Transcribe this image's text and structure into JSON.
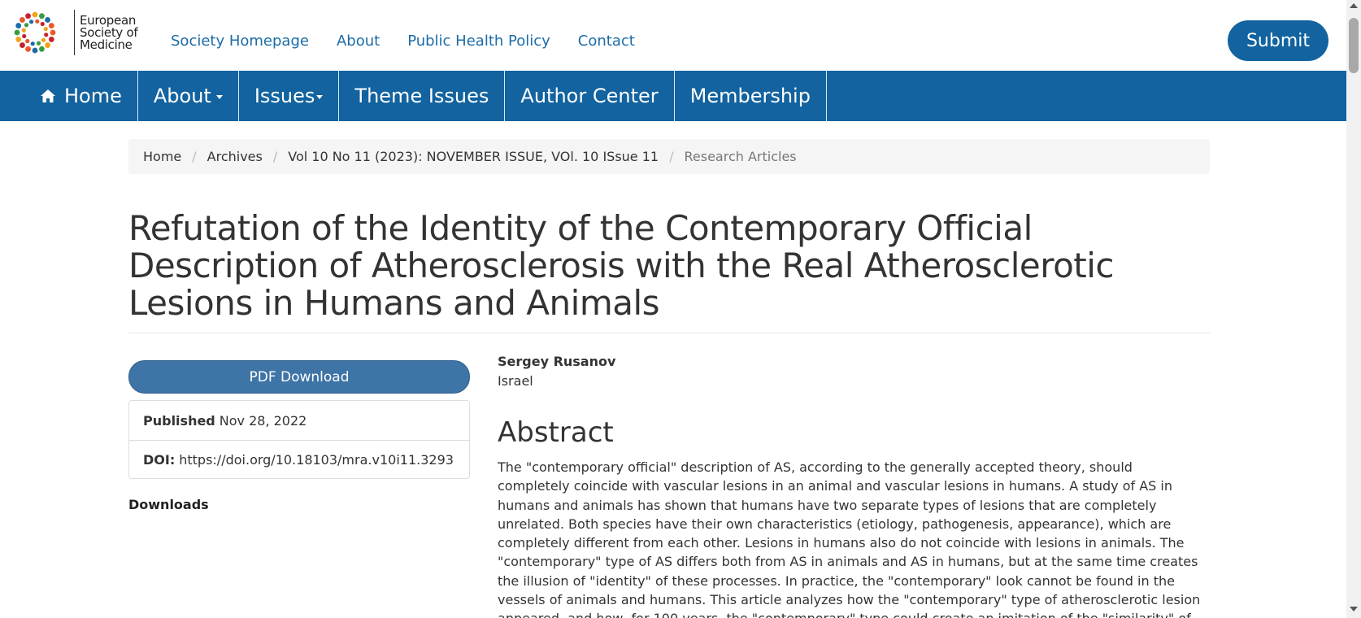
{
  "brand": {
    "name_lines": [
      "European",
      "Society of",
      "Medicine"
    ],
    "logo_dot_colors": [
      "#e8582a",
      "#f2a31b",
      "#1b6ca8",
      "#c8202f",
      "#3a9c3f"
    ]
  },
  "top_links": [
    "Society Homepage",
    "About",
    "Public Health Policy",
    "Contact"
  ],
  "submit_label": "Submit",
  "nav": {
    "home": "Home",
    "about": "About",
    "issues": "Issues",
    "theme_issues": "Theme Issues",
    "author_center": "Author Center",
    "membership": "Membership"
  },
  "breadcrumb": {
    "items": [
      "Home",
      "Archives",
      "Vol 10 No 11 (2023): NOVEMBER ISSUE, VOl. 10 ISsue 11"
    ],
    "current": "Research Articles"
  },
  "article": {
    "title": "Refutation of the Identity of the Contemporary Official Description of Atherosclerosis with the Real Atherosclerotic Lesions in Humans and Animals",
    "author": "Sergey Rusanov",
    "affiliation": "Israel",
    "pdf_label": "PDF Download",
    "published_label": "Published",
    "published_date": "Nov 28, 2022",
    "doi_label": "DOI:",
    "doi": "https://doi.org/10.18103/mra.v10i11.3293",
    "downloads_label": "Downloads",
    "abstract_heading": "Abstract",
    "abstract": "The \"contemporary official\" description of AS, according to the generally accepted theory, should completely coincide with vascular lesions in an animal and vascular lesions in humans. A study of AS in humans and animals has shown that humans have two separate types of lesions that are completely unrelated. Both species have their own characteristics (etiology, pathogenesis, appearance), which are completely different from each other. Lesions in humans also do not coincide with lesions in animals. The \"contemporary\" type of AS differs both from AS in animals and AS in humans, but at the same time creates the illusion of \"identity\" of these processes. In practice, the \"contemporary\" look cannot be found in the vessels of animals and humans. This article analyzes how the \"contemporary\" type of atherosclerotic lesion appeared, and how, for 100 years, the \"contemporary\" type could create an imitation of the \"similarity\" of completely different processes."
  },
  "colors": {
    "primary_blue": "#12639f",
    "link_blue": "#1b6ca8",
    "pdf_button": "#3e74a6"
  },
  "icons": {
    "home": "home-icon",
    "caret": "caret-down-icon"
  }
}
